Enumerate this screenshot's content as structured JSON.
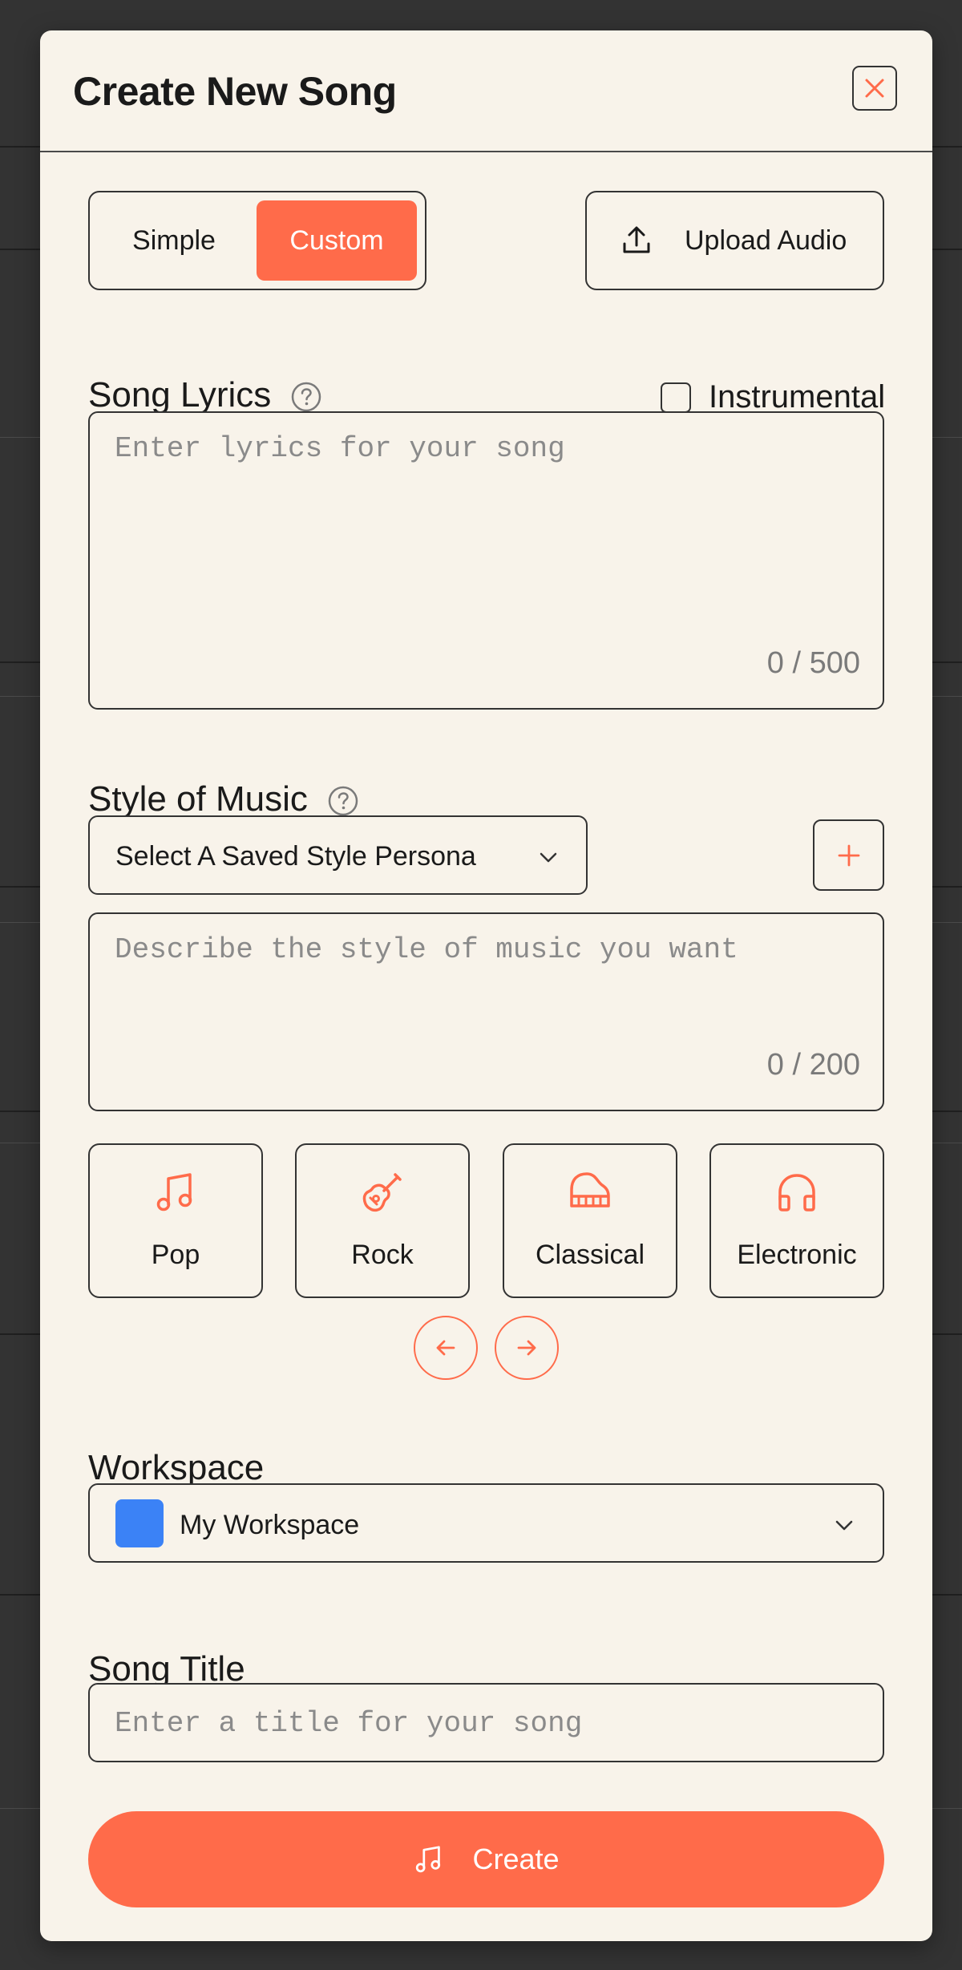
{
  "dialog": {
    "title": "Create New Song",
    "close_icon": "close-icon"
  },
  "mode": {
    "options": [
      "Simple",
      "Custom"
    ],
    "selected": "Custom"
  },
  "upload": {
    "label": "Upload Audio",
    "icon": "upload-icon"
  },
  "lyrics": {
    "label": "Song Lyrics",
    "placeholder": "Enter lyrics for your song",
    "counter": "0 / 500",
    "instrumental_label": "Instrumental",
    "instrumental_checked": false
  },
  "style": {
    "label": "Style of Music",
    "persona_select": "Select A Saved Style Persona",
    "placeholder": "Describe the style of music you want",
    "counter": "0 / 200"
  },
  "genres": [
    {
      "label": "Pop",
      "icon": "music-note-icon"
    },
    {
      "label": "Rock",
      "icon": "guitar-icon"
    },
    {
      "label": "Classical",
      "icon": "piano-icon"
    },
    {
      "label": "Electronic",
      "icon": "headphones-icon"
    }
  ],
  "workspace": {
    "label": "Workspace",
    "value": "My Workspace",
    "color": "#3b82f6"
  },
  "song_title": {
    "label": "Song Title",
    "placeholder": "Enter a title for your song"
  },
  "create": {
    "label": "Create",
    "icon": "music-note-icon"
  },
  "colors": {
    "accent": "#ff6b4a",
    "background": "#f8f3ea",
    "backdrop": "#333333"
  }
}
